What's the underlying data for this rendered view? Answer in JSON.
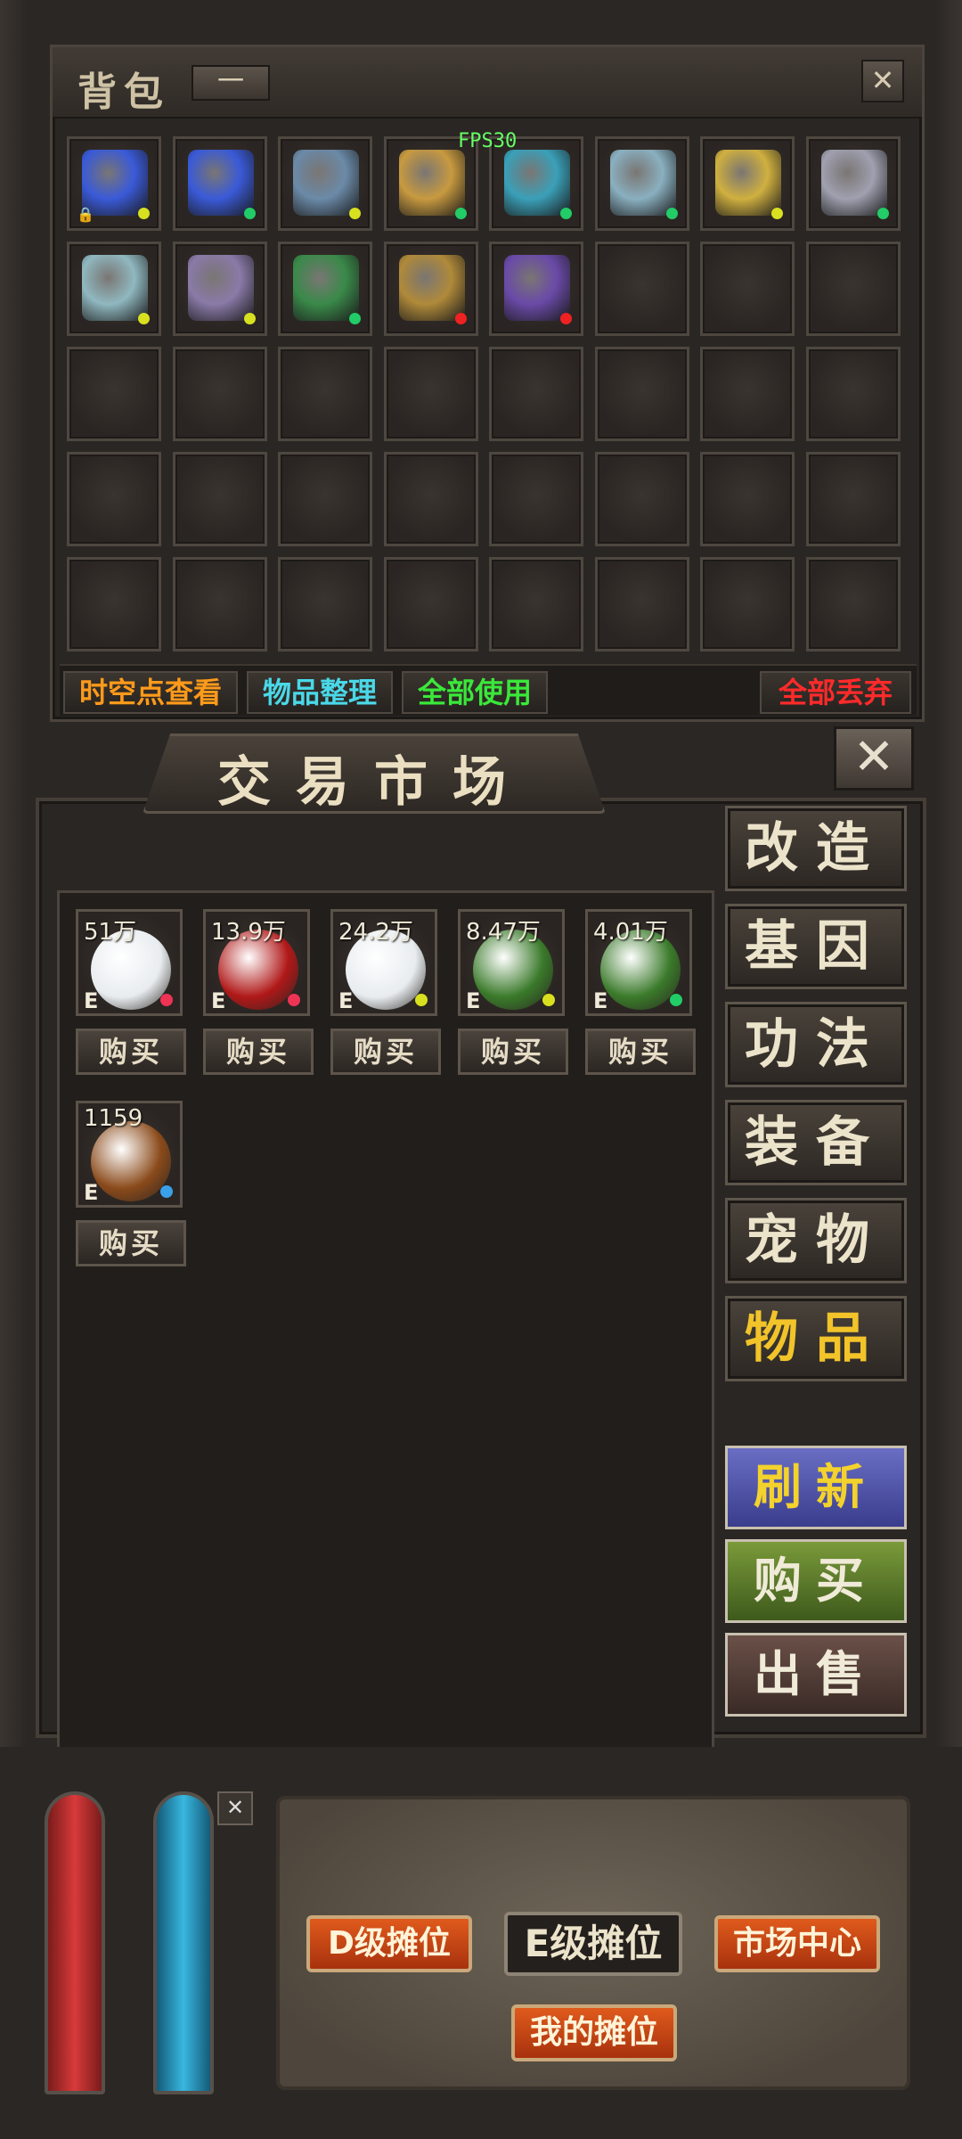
{
  "bag": {
    "title": "背包",
    "minimize_label": "一",
    "close_label": "✕",
    "fps": "FPS30",
    "items": [
      {
        "name": "blue-crystal-item-icon",
        "color": "#3a5ad8",
        "dot": "#d8e020",
        "locked": true
      },
      {
        "name": "blue-crystal-item-icon",
        "color": "#3a5ad8",
        "dot": "#22cc66"
      },
      {
        "name": "armor-item-icon",
        "color": "#6b8aa8",
        "dot": "#d8e020"
      },
      {
        "name": "bracer-item-icon",
        "color": "#c89a40",
        "dot": "#22cc66"
      },
      {
        "name": "lamp-item-icon",
        "color": "#3aa0b8",
        "dot": "#22cc66"
      },
      {
        "name": "robe-item-icon",
        "color": "#8ab0c0",
        "dot": "#22cc66"
      },
      {
        "name": "necklace-item-icon",
        "color": "#d0b040",
        "dot": "#d8e020"
      },
      {
        "name": "chain-item-icon",
        "color": "#a0a0b0",
        "dot": "#22cc66"
      },
      {
        "name": "wand-item-icon",
        "color": "#90b8c0",
        "dot": "#d8e020"
      },
      {
        "name": "bracelet-item-icon",
        "color": "#8a7aa8",
        "dot": "#d8e020"
      },
      {
        "name": "jade-ring-item-icon",
        "color": "#3a8a4a",
        "dot": "#22cc66"
      },
      {
        "name": "sapphire-ring-item-icon",
        "color": "#b08a3a",
        "dot": "#ee2222"
      },
      {
        "name": "gem-band-item-icon",
        "color": "#6a4aa8",
        "dot": "#ee2222"
      }
    ],
    "total_slots": 40,
    "actions": {
      "spacetime": "时空点查看",
      "sort": "物品整理",
      "use_all": "全部使用",
      "discard_all": "全部丢弃"
    },
    "action_colors": {
      "spacetime": "#ff9a1a",
      "sort": "#4ad8e8",
      "use_all": "#3ae83a",
      "discard_all": "#ff2a2a"
    }
  },
  "market": {
    "title": "交易市场",
    "close_label": "✕",
    "buy_label": "购买",
    "listings": [
      {
        "price": "51万",
        "grade": "E",
        "icon": "pearl-icon",
        "color": "#e8ecef",
        "dot": "#ee3355"
      },
      {
        "price": "13.9万",
        "grade": "E",
        "icon": "blood-cloth-icon",
        "color": "#b01818",
        "dot": "#ee3355"
      },
      {
        "price": "24.2万",
        "grade": "E",
        "icon": "pearl-icon",
        "color": "#e8ecef",
        "dot": "#d8e020"
      },
      {
        "price": "8.47万",
        "grade": "E",
        "icon": "herb-icon",
        "color": "#3a7a2a",
        "dot": "#d8e020"
      },
      {
        "price": "4.01万",
        "grade": "E",
        "icon": "herb-icon",
        "color": "#3a7a2a",
        "dot": "#22cc66"
      },
      {
        "price": "1159",
        "grade": "E",
        "icon": "root-icon",
        "color": "#8a4a1a",
        "dot": "#3aa0e8"
      }
    ],
    "categories": [
      "改造",
      "基因",
      "功法",
      "装备",
      "宠物",
      "物品"
    ],
    "active_category": "物品",
    "buttons": {
      "refresh": "刷新",
      "buy": "购买",
      "sell": "出售"
    }
  },
  "stalls": {
    "close_label": "✕",
    "d_stall": "D级摊位",
    "e_stall": "E级摊位",
    "market_center": "市场中心",
    "my_stall": "我的摊位"
  }
}
